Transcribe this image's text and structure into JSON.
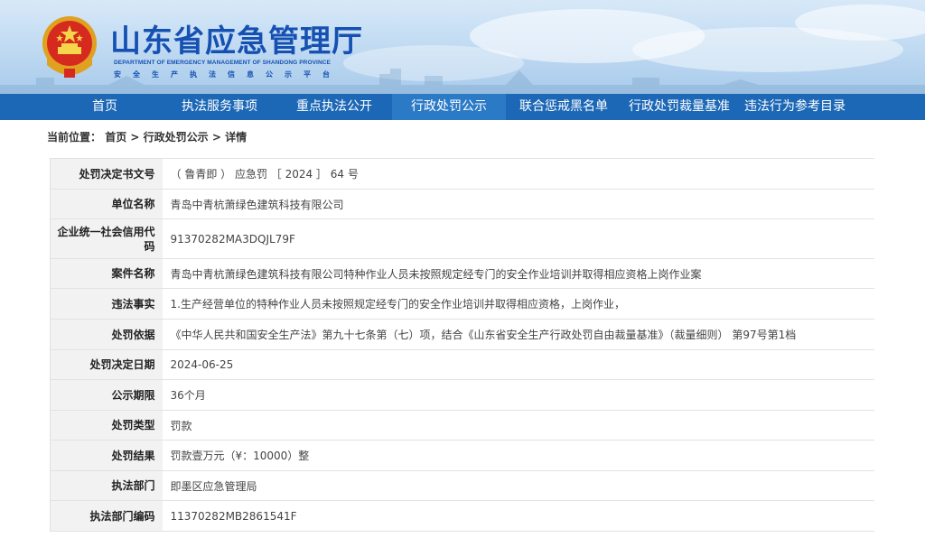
{
  "site": {
    "title": "山东省应急管理厅",
    "title_en": "DEPARTMENT OF EMERGENCY MANAGEMENT OF SHANDONG PROVINCE",
    "subtitle": "安全生产执法信息公示平台"
  },
  "nav": [
    {
      "label": "首页"
    },
    {
      "label": "执法服务事项"
    },
    {
      "label": "重点执法公开"
    },
    {
      "label": "行政处罚公示",
      "active": true
    },
    {
      "label": "联合惩戒黑名单"
    },
    {
      "label": "行政处罚裁量基准"
    },
    {
      "label": "违法行为参考目录"
    }
  ],
  "breadcrumb": {
    "prefix": "当前位置：",
    "home": "首页",
    "sep1": " > ",
    "section": "行政处罚公示",
    "sep2": " > ",
    "current": "详情"
  },
  "detail": [
    {
      "label": "处罚决定书文号",
      "value": "（ 鲁青即 ） 应急罚 ［ 2024 ］ 64 号"
    },
    {
      "label": "单位名称",
      "value": "青岛中青杭萧绿色建筑科技有限公司"
    },
    {
      "label": "企业统一社会信用代码",
      "value": "91370282MA3DQJL79F"
    },
    {
      "label": "案件名称",
      "value": "青岛中青杭萧绿色建筑科技有限公司特种作业人员未按照规定经专门的安全作业培训并取得相应资格上岗作业案"
    },
    {
      "label": "违法事实",
      "value": "1.生产经营单位的特种作业人员未按照规定经专门的安全作业培训并取得相应资格，上岗作业，"
    },
    {
      "label": "处罚依据",
      "value": "《中华人民共和国安全生产法》第九十七条第（七）项，结合《山东省安全生产行政处罚自由裁量基准》（裁量细则） 第97号第1档"
    },
    {
      "label": "处罚决定日期",
      "value": "2024-06-25"
    },
    {
      "label": "公示期限",
      "value": "36个月"
    },
    {
      "label": "处罚类型",
      "value": "罚款"
    },
    {
      "label": "处罚结果",
      "value": "罚款壹万元（¥：10000）整"
    },
    {
      "label": "执法部门",
      "value": "即墨区应急管理局"
    },
    {
      "label": "执法部门编码",
      "value": "11370282MB2861541F"
    }
  ],
  "colors": {
    "nav_bg": "#1d68b6",
    "nav_active": "#2b7ac6",
    "title": "#1550b2",
    "label_bg": "#f2f2f2"
  },
  "icons": {
    "emblem": "national-emblem-icon"
  }
}
